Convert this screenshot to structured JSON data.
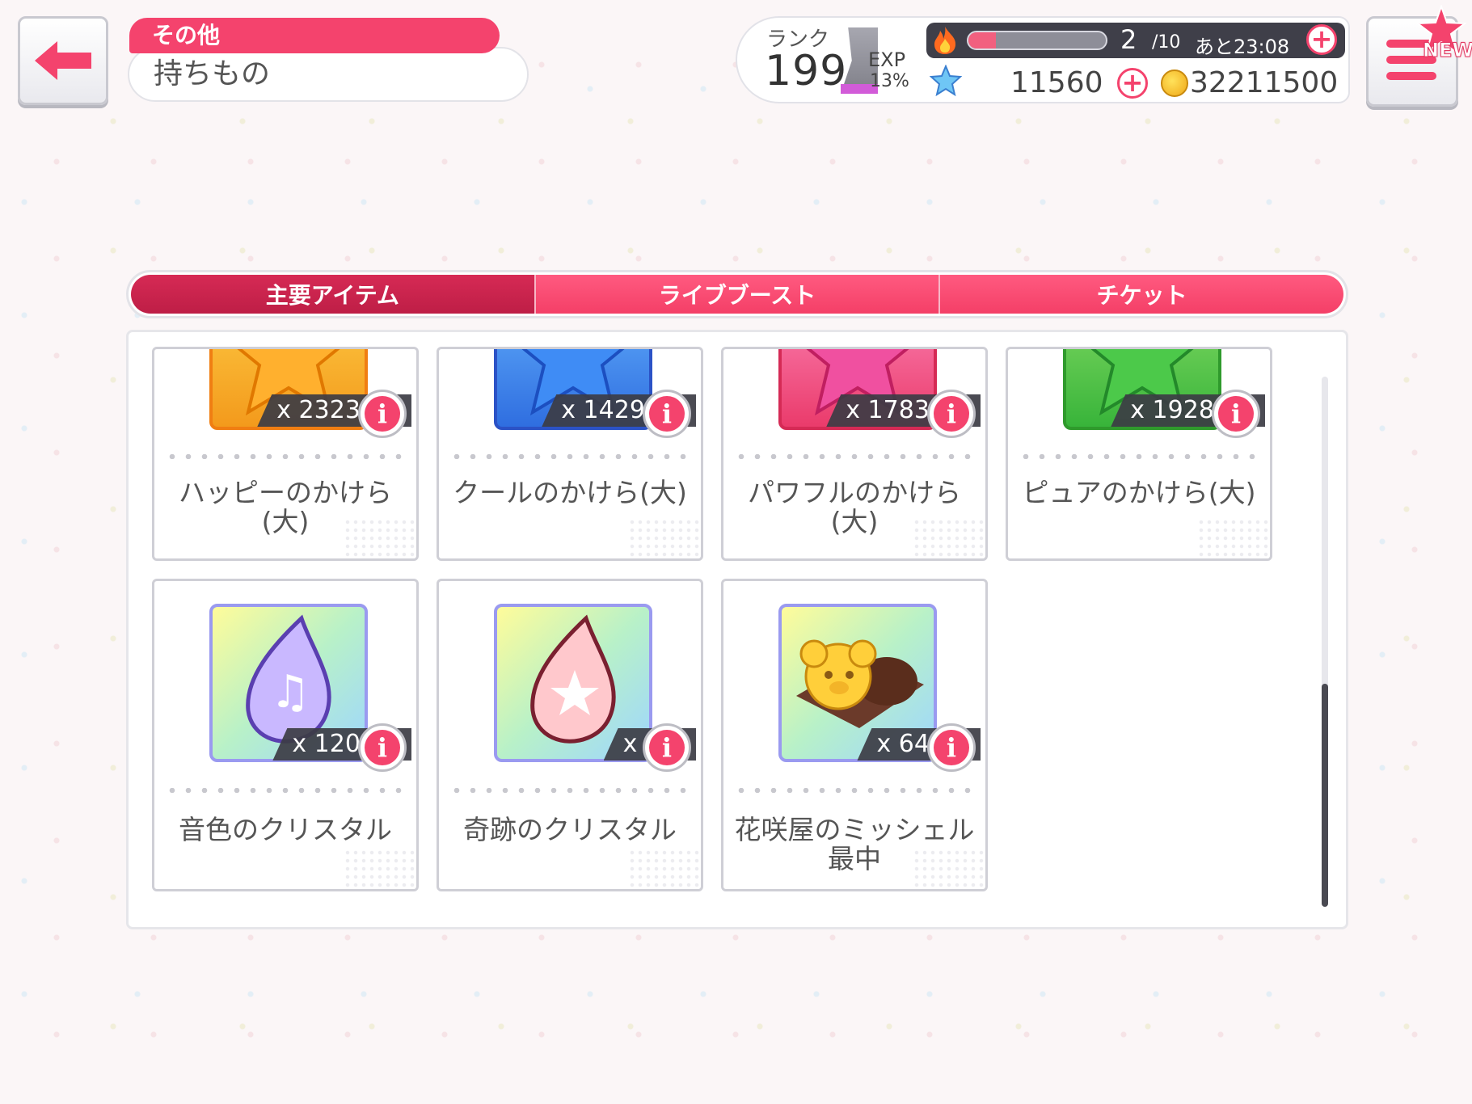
{
  "header": {
    "category": "その他",
    "title": "持ちもの"
  },
  "status": {
    "rank_label": "ランク",
    "rank": "199",
    "exp_label": "EXP",
    "exp_percent": "13%",
    "stamina_current": "2",
    "stamina_max": "/10",
    "stamina_timer": "あと23:08",
    "stamina_fraction": 0.2,
    "star_gems": "11560",
    "coins": "32211500"
  },
  "menu": {
    "new_badge": "NEW"
  },
  "tabs": [
    {
      "label": "主要アイテム",
      "active": true
    },
    {
      "label": "ライブブースト",
      "active": false
    },
    {
      "label": "チケット",
      "active": false
    }
  ],
  "items": [
    {
      "name": "ハッピーのかけら(大)",
      "qty": "x 23233",
      "color": "#f39a1c"
    },
    {
      "name": "クールのかけら(大)",
      "qty": "x 14298",
      "color": "#2f6ee0"
    },
    {
      "name": "パワフルのかけら(大)",
      "qty": "x 17832",
      "color": "#ea3b6b"
    },
    {
      "name": "ピュアのかけら(大)",
      "qty": "x 19284",
      "color": "#38b43a"
    },
    {
      "name": "音色のクリスタル",
      "qty": "x 1200",
      "color": "#8f8ff0"
    },
    {
      "name": "奇跡のクリスタル",
      "qty": "x 1",
      "color": "#8f8ff0"
    },
    {
      "name": "花咲屋のミッシェル最中",
      "qty": "x 647",
      "color": "#8f8ff0"
    }
  ]
}
